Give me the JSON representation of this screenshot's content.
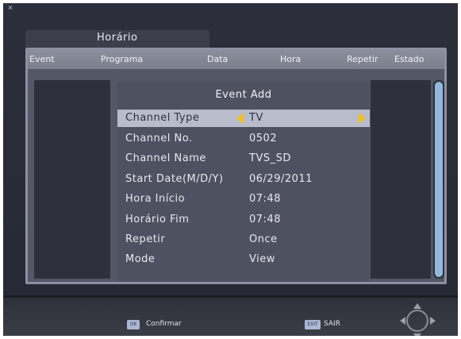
{
  "window": {
    "title": "Horário"
  },
  "table": {
    "headers": [
      "Event",
      "Programa",
      "Data",
      "Hora",
      "Repetir",
      "Estado"
    ]
  },
  "dialog": {
    "title": "Event Add",
    "rows": [
      {
        "label": "Channel Type",
        "value": "TV",
        "selected": true
      },
      {
        "label": "Channel No.",
        "value": "0502"
      },
      {
        "label": "Channel Name",
        "value": "TVS_SD"
      },
      {
        "label": "Start Date(M/D/Y)",
        "value": "06/29/2011"
      },
      {
        "label": "Hora Início",
        "value": "07:48"
      },
      {
        "label": "Horário Fim",
        "value": "07:48"
      },
      {
        "label": "Repetir",
        "value": "Once"
      },
      {
        "label": "Mode",
        "value": "View"
      }
    ]
  },
  "footer": {
    "ok_icon": "OK",
    "ok_label": "Confirmar",
    "exit_icon": "EXIT",
    "exit_label": "SAIR"
  },
  "icons": {
    "selector_arrows": "triangle-left/right",
    "navigation": "dpad-icon"
  },
  "colors": {
    "selector_arrow": "#f0c020",
    "selected_row": "#b9bccb",
    "scrollbar": "#93b8dc"
  }
}
